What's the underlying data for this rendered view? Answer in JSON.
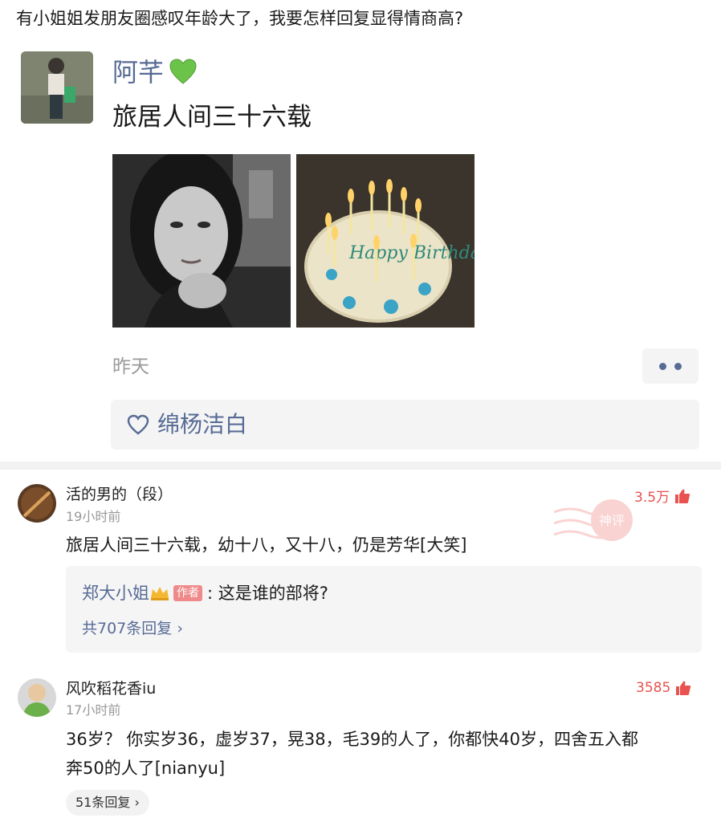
{
  "question": "有小姐姐发朋友圈感叹年龄大了，我要怎样回复显得情商高?",
  "moment": {
    "name": "阿芊",
    "name_emoji": "green-heart-icon",
    "text": "旅居人间三十六载",
    "time": "昨天",
    "like_name": "绵杨洁白",
    "photos": [
      "selfie-photo",
      "birthday-cake-photo"
    ],
    "cake_text": "Happy Birthday"
  },
  "comments": [
    {
      "user": "活的男的（段）",
      "time": "19小时前",
      "text": "旅居人间三十六载，幼十八，又十八，仍是芳华[大笑]",
      "likes": "3.5万",
      "stamp": "神评",
      "reply": {
        "user": "郑大小姐",
        "tag": "作者",
        "text": "这是谁的部将?"
      },
      "reply_total": "共707条回复"
    },
    {
      "user": "风吹稻花香iu",
      "time": "17小时前",
      "text_line1": "36岁？ 你实岁36，虚岁37，晃38，毛39的人了，你都快40岁，四舍五入都",
      "text_line2": "奔50的人了[nianyu]",
      "likes": "3585",
      "reply_total": "51条回复"
    }
  ],
  "colors": {
    "link_blue": "#576b95",
    "like_red": "#e8534f",
    "gray_text": "#999999",
    "bg_gray": "#f4f4f4"
  }
}
